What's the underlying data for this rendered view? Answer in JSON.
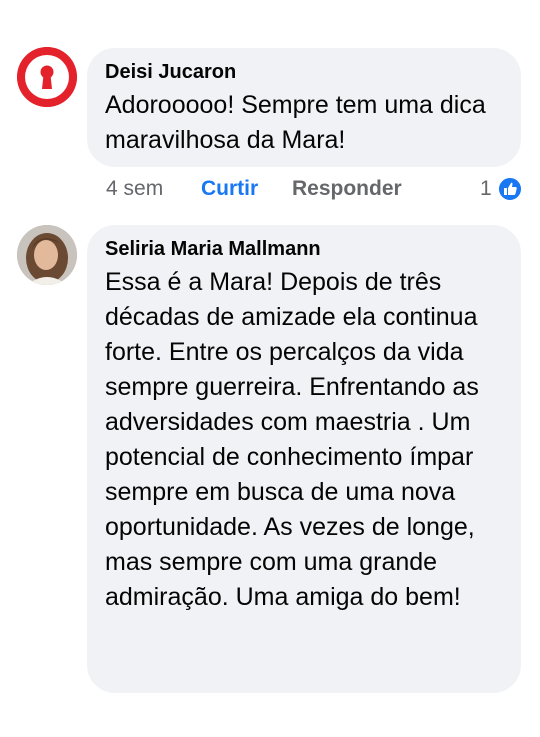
{
  "comments": [
    {
      "author": "Deisi Jucaron",
      "text": "Adorooooo! Sempre tem uma dica maravilhosa da Mara!",
      "time": "4 sem",
      "like_label": "Curtir",
      "reply_label": "Responder",
      "reaction_count": "1",
      "avatar_icon": "keyhole-icon",
      "avatar_color": "#e4222b"
    },
    {
      "author": "Seliria Maria Mallmann",
      "text": "Essa é a Mara! Depois de três décadas de amizade  ela continua forte. Entre os percalços da vida sempre guerreira. Enfrentando as adversidades com maestria . Um potencial de conhecimento ímpar sempre em busca de uma nova oportunidade.  As vezes de longe,  mas sempre com uma grande admiração. Uma amiga do bem!",
      "avatar_icon": "profile-photo"
    }
  ],
  "colors": {
    "bubble": "#f0f2f5",
    "link_blue": "#1877f2",
    "secondary_text": "#65676b"
  }
}
